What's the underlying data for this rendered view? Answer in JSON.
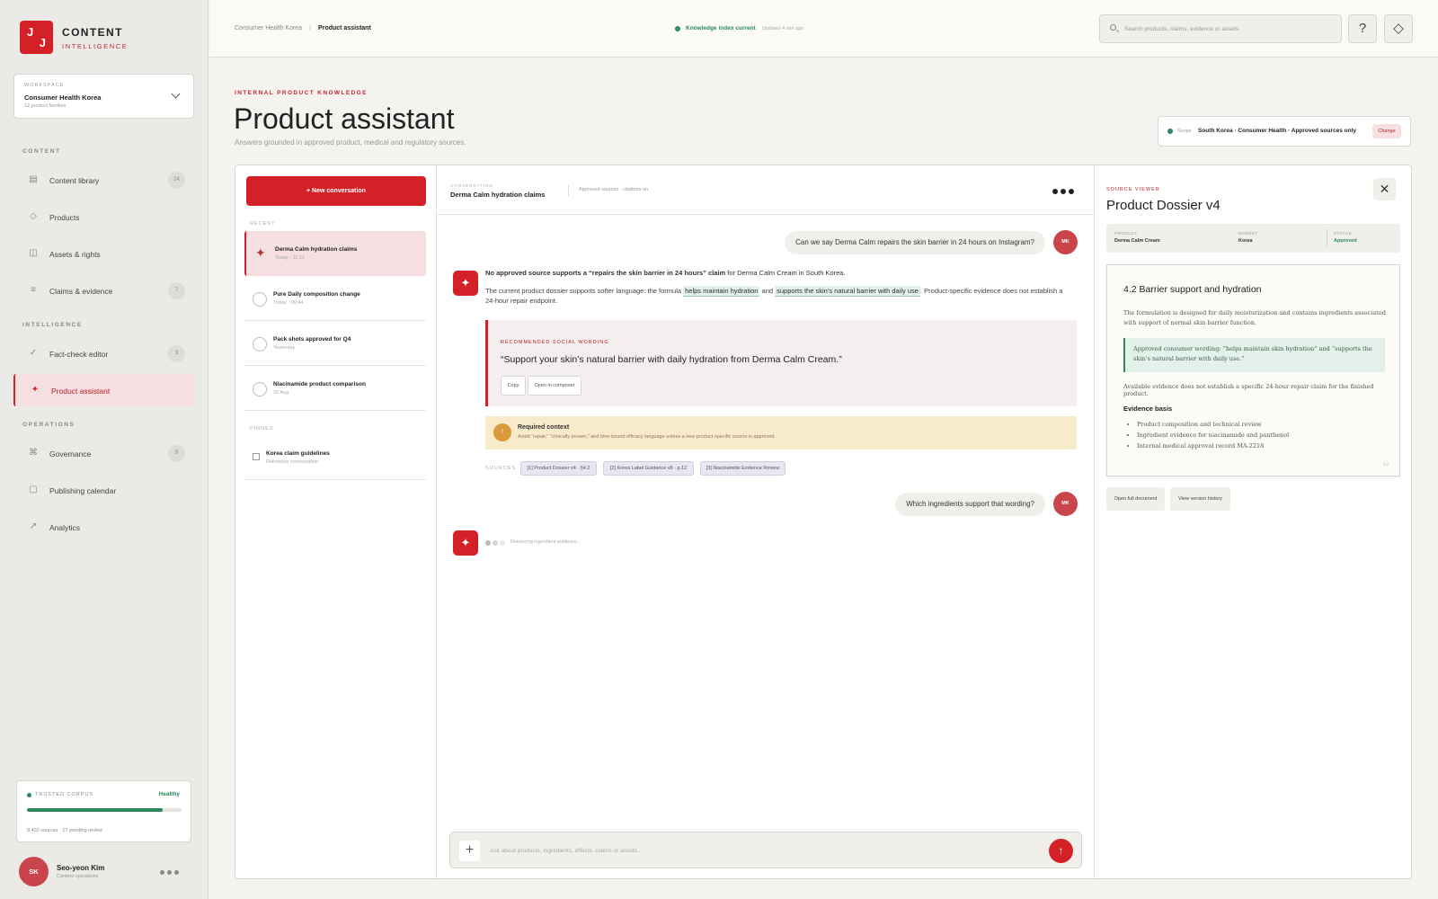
{
  "brand": {
    "logo_l1": "J",
    "logo_l2": "J",
    "line1": "CONTENT",
    "line2": "INTELLIGENCE"
  },
  "workspace": {
    "label": "WORKSPACE",
    "name": "Consumer Health Korea",
    "sub": "12 product families"
  },
  "sidebar": {
    "section_content": "CONTENT",
    "section_intelligence": "INTELLIGENCE",
    "section_operations": "OPERATIONS",
    "items": [
      {
        "icon": "▤",
        "label": "Content library",
        "count": "24"
      },
      {
        "icon": "◇",
        "label": "Products",
        "count": ""
      },
      {
        "icon": "◫",
        "label": "Assets & rights",
        "count": ""
      },
      {
        "icon": "≡",
        "label": "Claims & evidence",
        "count": "7"
      },
      {
        "icon": "✓",
        "label": "Fact-check editor",
        "count": "3"
      },
      {
        "icon": "✦",
        "label": "Product assistant",
        "count": ""
      },
      {
        "icon": "⌘",
        "label": "Governance",
        "count": "9"
      },
      {
        "icon": "▢",
        "label": "Publishing calendar",
        "count": ""
      },
      {
        "icon": "↗",
        "label": "Analytics",
        "count": ""
      }
    ],
    "active_index": 5
  },
  "corpus": {
    "label": "TRUSTED CORPUS",
    "status": "Healthy",
    "progress": 0.88,
    "footer": "8,402 sources · 17 pending review",
    "status_color": "#2c8a5e"
  },
  "user": {
    "initials": "SK",
    "name": "Seo-yeon Kim",
    "role": "Content operations"
  },
  "topbar": {
    "breadcrumb_root": "Consumer Health Korea",
    "breadcrumb_sep": "/",
    "breadcrumb_current": "Product assistant",
    "index_status": "Knowledge index current",
    "index_updated": "Updated 4 min ago",
    "search_placeholder": "Search products, claims, evidence or assets",
    "help_icon": "?",
    "theme_icon": "◇"
  },
  "header": {
    "eyebrow": "INTERNAL PRODUCT KNOWLEDGE",
    "title": "Product assistant",
    "subtitle": "Answers grounded in approved product, medical and regulatory sources.",
    "scope_label": "Scope",
    "scope_value": "South Korea · Consumer Health · Approved sources only",
    "scope_change": "Change"
  },
  "conversations": {
    "new_label": "+ New conversation",
    "recent_label": "RECENT",
    "pinned_label": "PINNED",
    "recent": [
      {
        "title": "Derma Calm hydration claims",
        "meta": "Today · 11:31"
      },
      {
        "title": "Pure Daily composition change",
        "meta": "Today · 09:44"
      },
      {
        "title": "Pack shots approved for Q4",
        "meta": "Yesterday"
      },
      {
        "title": "Niacinamide product comparison",
        "meta": "22 Aug"
      }
    ],
    "pinned": [
      {
        "title": "Korea claim guidelines",
        "meta": "Reference conversation"
      }
    ]
  },
  "chat": {
    "header_label": "CONVERSATION",
    "header_title": "Derma Calm hydration claims",
    "header_meta": "Approved sources · citations on",
    "user_initials": "MK",
    "q1": "Can we say Derma Calm repairs the skin barrier in 24 hours on Instagram?",
    "a1_bold": "No approved source supports a “repairs the skin barrier in 24 hours” claim",
    "a1_rest": " for Derma Calm Cream in South Korea.",
    "a2_pre": "The current product dossier supports softer language: the formula ",
    "a2_hl1": "helps maintain hydration",
    "a2_mid": " and ",
    "a2_hl2": "supports the skin’s natural barrier with daily use",
    "a2_post": ". Product-specific evidence does not establish a 24-hour repair endpoint.",
    "rec_label": "RECOMMENDED SOCIAL WORDING",
    "rec_quote": "“Support your skin’s natural barrier with daily hydration from Derma Calm Cream.”",
    "rec_copy": "Copy",
    "rec_open": "Open in composer",
    "req_icon": "!",
    "req_title": "Required context",
    "req_text": "Avoid “repair,” “clinically proven,” and time-bound efficacy language unless a new product-specific source is approved.",
    "sources_label": "SOURCES",
    "sources": [
      "[1] Product Dossier v4 · §4.2",
      "[2] Korea Label Guidance v8 · p.12",
      "[3] Niacinamide Evidence Review"
    ],
    "q2": "Which ingredients support that wording?",
    "typing": "Retrieving ingredient evidence...",
    "composer_placeholder": "Ask about products, ingredients, effects, claims or assets...",
    "assistant_icon": "✦",
    "send_icon": "↑",
    "plus_icon": "+"
  },
  "viewer": {
    "label": "SOURCE VIEWER",
    "title": "Product Dossier v4",
    "close_icon": "✕",
    "meta": [
      {
        "k": "PRODUCT",
        "v": "Derma Calm Cream"
      },
      {
        "k": "MARKET",
        "v": "Korea"
      },
      {
        "k": "STATUS",
        "v": "Approved"
      }
    ],
    "doc_heading": "4.2 Barrier support and hydration",
    "doc_p1": "The formulation is designed for daily moisturization and contains ingredients associated with support of normal skin barrier function.",
    "doc_quote": "Approved consumer wording: “helps maintain skin hydration” and “supports the skin’s natural barrier with daily use.”",
    "doc_p2": "Available evidence does not establish a specific 24-hour repair claim for the finished product.",
    "evidence_heading": "Evidence basis",
    "evidence": [
      "Product composition and technical review",
      "Ingredient evidence for niacinamide and panthenol",
      "Internal medical approval record MA-2218"
    ],
    "page": "12",
    "btn_open": "Open full document",
    "btn_history": "View version history"
  },
  "colors": {
    "accent": "#d42027",
    "success": "#2c8a5e",
    "warning": "#f8ebca"
  }
}
